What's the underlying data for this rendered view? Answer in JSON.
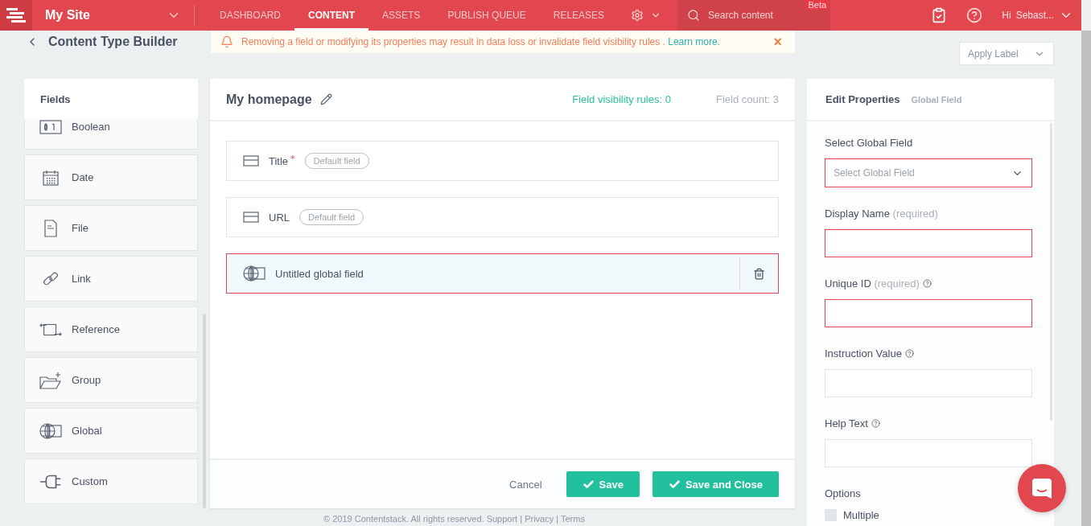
{
  "nav": {
    "site": "My Site",
    "tabs": [
      {
        "label": "DASHBOARD",
        "selected": false
      },
      {
        "label": "CONTENT",
        "selected": true
      },
      {
        "label": "ASSETS",
        "selected": false
      },
      {
        "label": "PUBLISH QUEUE",
        "selected": false
      },
      {
        "label": "RELEASES",
        "selected": false
      }
    ],
    "search": {
      "placeholder": "Search content",
      "badge": "Beta"
    },
    "greeting": "Hi",
    "user": "Sebast..."
  },
  "page_title": "Content Type Builder",
  "alert": {
    "message": "Removing a field or modifying its properties may result in data loss or invalidate field visibility rules .",
    "link": "Learn more.",
    "close": "×"
  },
  "apply_label": "Apply Label",
  "fields_panel": {
    "title": "Fields",
    "items": [
      {
        "label": "Boolean",
        "kind": "boolean"
      },
      {
        "label": "Date",
        "kind": "date"
      },
      {
        "label": "File",
        "kind": "file"
      },
      {
        "label": "Link",
        "kind": "link"
      },
      {
        "label": "Reference",
        "kind": "reference"
      },
      {
        "label": "Group",
        "kind": "group"
      },
      {
        "label": "Global",
        "kind": "global"
      },
      {
        "label": "Custom",
        "kind": "custom"
      }
    ]
  },
  "builder": {
    "title": "My homepage",
    "visibility_rules": "Field visibility rules: 0",
    "field_count": "Field count: 3",
    "fields": [
      {
        "label": "Title",
        "kind": "text",
        "required_mark": "*",
        "badge": "Default field",
        "selected": false
      },
      {
        "label": "URL",
        "kind": "text",
        "badge": "Default field",
        "selected": false
      },
      {
        "label": "Untitled global field",
        "kind": "global",
        "selected": true
      }
    ],
    "buttons": {
      "cancel": "Cancel",
      "save": "Save",
      "save_close": "Save and Close"
    }
  },
  "properties": {
    "title": "Edit Properties",
    "subtitle": "Global Field",
    "fields": [
      {
        "label": "Select Global Field",
        "kind": "select",
        "placeholder": "Select Global Field",
        "invalid": true,
        "help": false
      },
      {
        "label": "Display Name",
        "hint": "(required)",
        "kind": "input",
        "invalid": true,
        "help": false
      },
      {
        "label": "Unique ID",
        "hint": "(required)",
        "kind": "input",
        "invalid": true,
        "help": true
      },
      {
        "label": "Instruction Value",
        "kind": "input",
        "invalid": false,
        "help": true
      },
      {
        "label": "Help Text",
        "kind": "input",
        "invalid": false,
        "help": true
      }
    ],
    "options_title": "Options",
    "options": [
      {
        "label": "Multiple",
        "checked": false
      }
    ]
  },
  "footer": "© 2019 Contentstack. All rights reserved. Support | Privacy | Terms"
}
